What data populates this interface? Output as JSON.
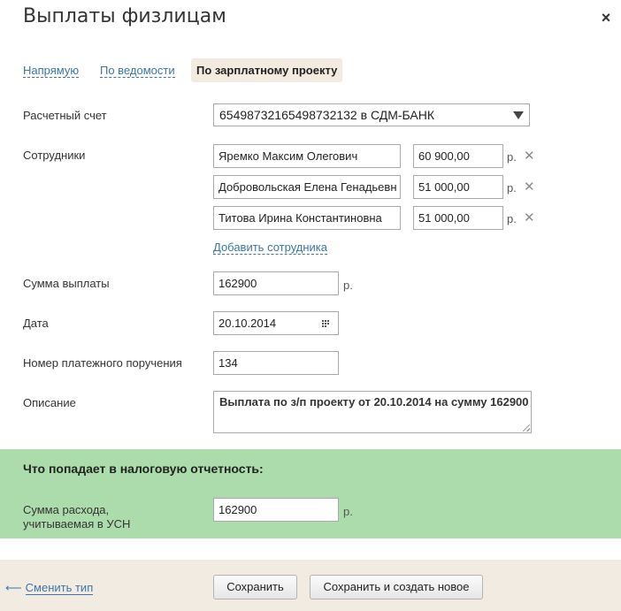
{
  "window": {
    "title": "Выплаты физлицам",
    "close_icon": "×"
  },
  "tabs": [
    {
      "label": "Напрямую",
      "active": false
    },
    {
      "label": "По ведомости",
      "active": false
    },
    {
      "label": "По зарплатному проекту",
      "active": true
    }
  ],
  "form": {
    "account": {
      "label": "Расчетный счет",
      "value": "65498732165498732132 в СДМ-БАНК"
    },
    "employees": {
      "label": "Сотрудники",
      "rows": [
        {
          "name": "Яремко Максим Олегович",
          "amount": "60 900,00",
          "unit": "р.",
          "remove": "✕"
        },
        {
          "name": "Добровольская Елена Генадьевн",
          "amount": "51 000,00",
          "unit": "р.",
          "remove": "✕"
        },
        {
          "name": "Титова Ирина Константиновна",
          "amount": "51 000,00",
          "unit": "р.",
          "remove": "✕"
        }
      ],
      "add_label": "Добавить сотрудника"
    },
    "sum": {
      "label": "Сумма выплаты",
      "value": "162900",
      "unit": "р."
    },
    "date": {
      "label": "Дата",
      "value": "20.10.2014"
    },
    "order_number": {
      "label": "Номер платежного поручения",
      "value": "134"
    },
    "description": {
      "label": "Описание",
      "value": "Выплата по з/п проекту от 20.10.2014 на сумму 162900"
    }
  },
  "tax": {
    "title": "Что попадает в налоговую отчетность:",
    "label_line1": "Сумма расхода,",
    "label_line2": "учитываемая в УСН",
    "value": "162900",
    "unit": "р."
  },
  "footer": {
    "back_arrow": "⟵",
    "back_label": "Сменить тип",
    "save_label": "Сохранить",
    "save_new_label": "Сохранить и создать новое"
  },
  "colors": {
    "link": "#3a76a8",
    "active_tab_bg": "#f3ebe0",
    "tax_panel_bg": "#acdcac",
    "footer_bg": "#f2ebe2"
  }
}
